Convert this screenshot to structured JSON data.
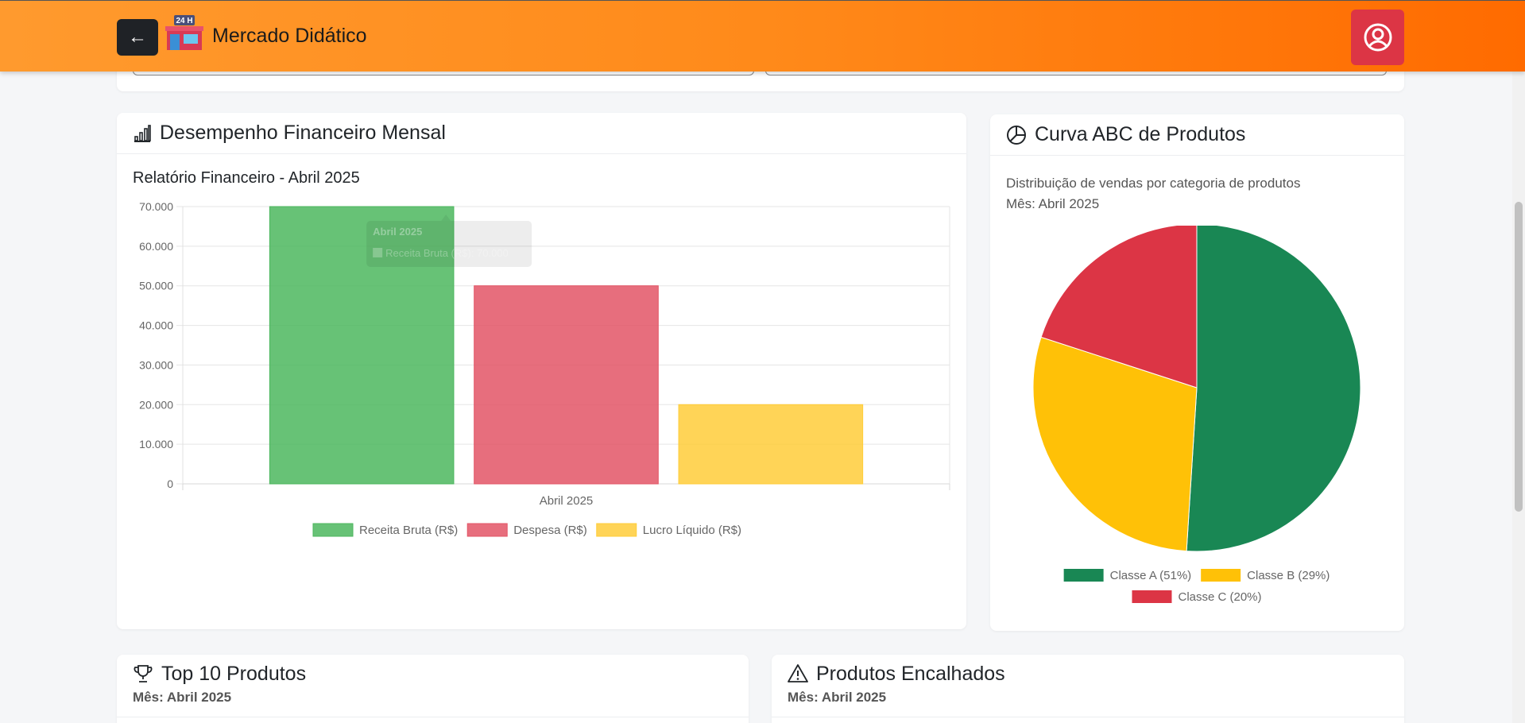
{
  "header": {
    "brand": "Mercado Didático",
    "logo_badge": "24 H",
    "back_icon": "arrow-left-icon",
    "profile_icon": "user-circle-icon",
    "bg_start": "#ff9a2e",
    "bg_end": "#ff6b00"
  },
  "financial": {
    "title": "Desempenho Financeiro Mensal",
    "icon": "bar-chart-icon",
    "subtitle": "Relatório Financeiro - Abril 2025",
    "tooltip_title": "Abril 2025",
    "tooltip_body": "Receita Bruta (R$): 70.000"
  },
  "abc": {
    "title": "Curva ABC de Produtos",
    "icon": "pie-chart-icon",
    "desc_line1": "Distribuição de vendas por categoria de produtos",
    "desc_line2": "Mês: Abril 2025"
  },
  "top10": {
    "title": "Top 10 Produtos",
    "icon": "trophy-icon",
    "month": "Mês: Abril 2025"
  },
  "encalhados": {
    "title": "Produtos Encalhados",
    "icon": "warning-icon",
    "month": "Mês: Abril 2025"
  },
  "chart_data": [
    {
      "type": "bar",
      "title": "Relatório Financeiro - Abril 2025",
      "categories": [
        "Abril 2025"
      ],
      "series": [
        {
          "name": "Receita Bruta (R$)",
          "values": [
            70000
          ],
          "color": "#4cb75e"
        },
        {
          "name": "Despesa (R$)",
          "values": [
            50000
          ],
          "color": "#e35566"
        },
        {
          "name": "Lucro Líquido (R$)",
          "values": [
            20000
          ],
          "color": "#ffcd39"
        }
      ],
      "ylim": [
        0,
        70000
      ],
      "yticks": [
        "0",
        "10.000",
        "20.000",
        "30.000",
        "40.000",
        "50.000",
        "60.000",
        "70.000"
      ],
      "grid": true,
      "legend": "bottom"
    },
    {
      "type": "pie",
      "labels": [
        "Classe A (51%)",
        "Classe B (29%)",
        "Classe C (20%)"
      ],
      "values": [
        51,
        29,
        20
      ],
      "colors": [
        "#198754",
        "#ffc107",
        "#dc3545"
      ],
      "legend": "bottom"
    }
  ]
}
